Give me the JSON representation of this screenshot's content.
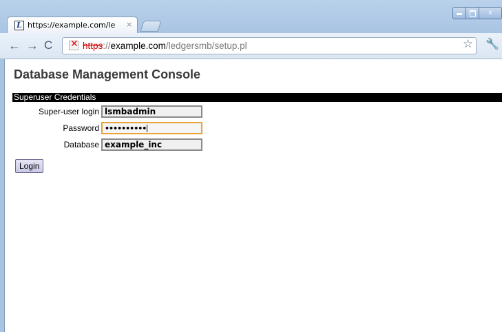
{
  "browser": {
    "tab": {
      "favicon_letter": "L",
      "title": "https://example.com/ledgersm",
      "close_glyph": "×"
    },
    "nav": {
      "back": "←",
      "forward": "→",
      "reload": "C"
    },
    "address_bar": {
      "security_glyph": "✕",
      "scheme": "https",
      "separator": "://",
      "host": "example.com",
      "path": "/ledgersmb/setup.pl"
    },
    "icons": {
      "star": "☆",
      "wrench": "🔧"
    },
    "window_controls": {
      "close": "x"
    }
  },
  "page": {
    "title": "Database Management Console",
    "section_header": "Superuser Credentials",
    "form": {
      "fields": [
        {
          "label": "Super-user login",
          "value": "lsmbadmin"
        },
        {
          "label": "Password",
          "value": "••••••••••"
        },
        {
          "label": "Database",
          "value": "example_inc"
        }
      ],
      "login_label": "Login"
    }
  },
  "colors": {
    "focus_border": "#e8a43a",
    "section_bar": "#000000",
    "insecure_scheme": "#cc0000"
  }
}
